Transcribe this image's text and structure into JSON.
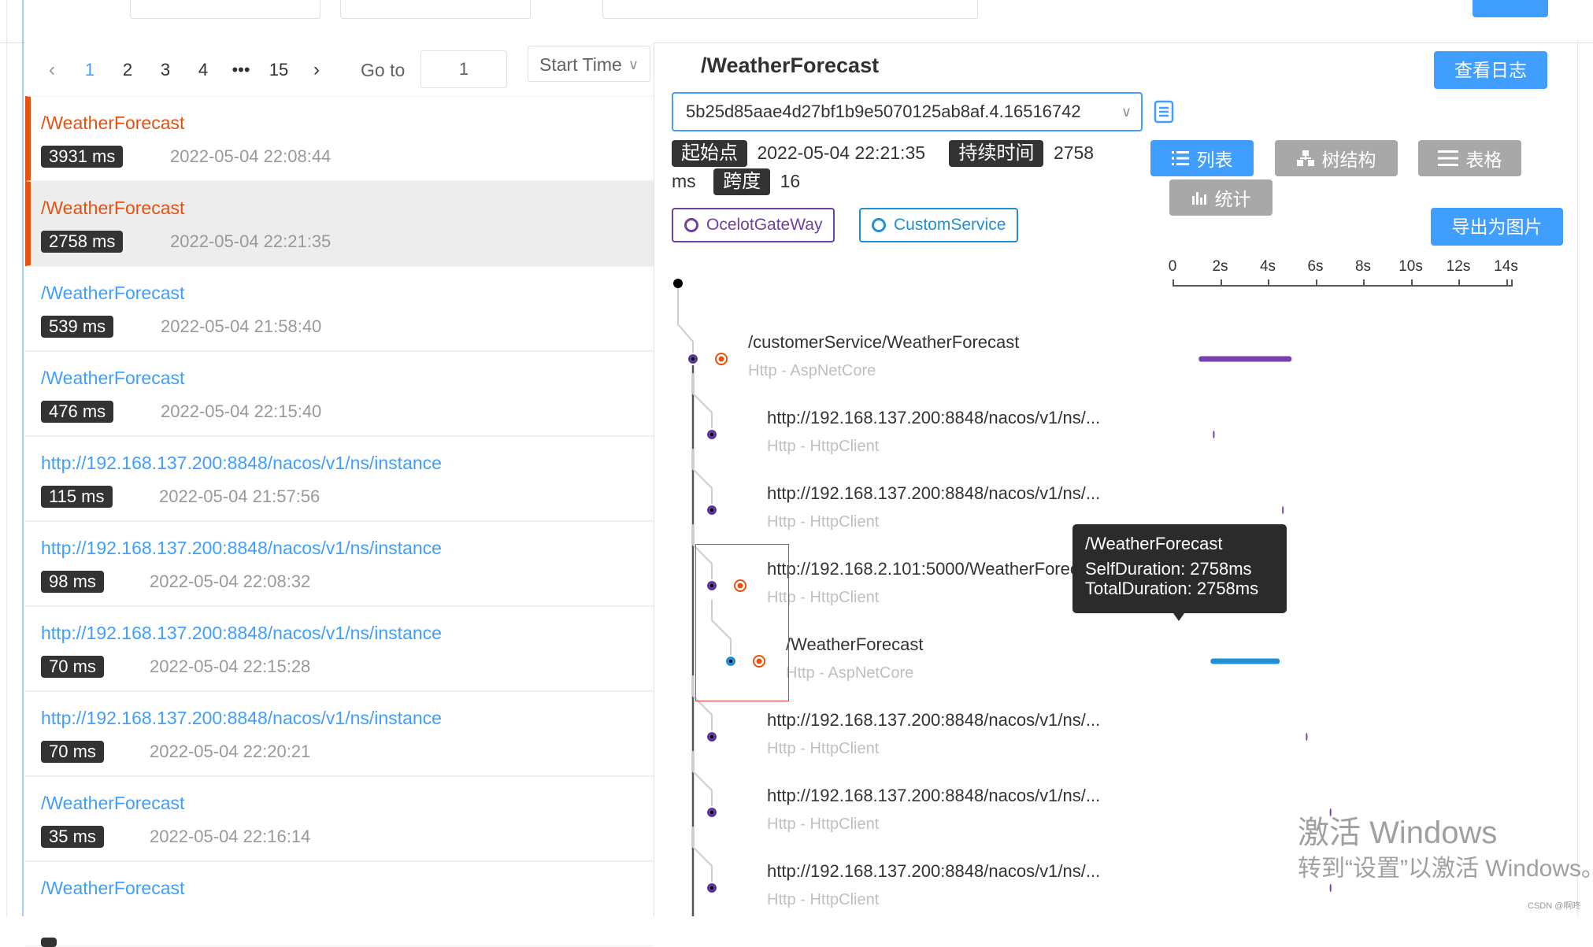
{
  "pagination": {
    "pages": [
      "1",
      "2",
      "3",
      "4",
      "•••",
      "15"
    ],
    "active_page": "1",
    "prev_icon": "chevron-left-icon",
    "next_icon": "chevron-right-icon",
    "goto_label": "Go to",
    "goto_value": "1",
    "sort_value": "Start Time"
  },
  "traces": [
    {
      "name": "/WeatherForecast",
      "duration": "3931 ms",
      "time": "2022-05-04 22:08:44",
      "error": true,
      "selected": false
    },
    {
      "name": "/WeatherForecast",
      "duration": "2758 ms",
      "time": "2022-05-04 22:21:35",
      "error": true,
      "selected": true
    },
    {
      "name": "/WeatherForecast",
      "duration": "539 ms",
      "time": "2022-05-04 21:58:40",
      "error": false,
      "selected": false
    },
    {
      "name": "/WeatherForecast",
      "duration": "476 ms",
      "time": "2022-05-04 22:15:40",
      "error": false,
      "selected": false
    },
    {
      "name": "http://192.168.137.200:8848/nacos/v1/ns/instance",
      "duration": "115 ms",
      "time": "2022-05-04 21:57:56",
      "error": false,
      "selected": false
    },
    {
      "name": "http://192.168.137.200:8848/nacos/v1/ns/instance",
      "duration": "98 ms",
      "time": "2022-05-04 22:08:32",
      "error": false,
      "selected": false
    },
    {
      "name": "http://192.168.137.200:8848/nacos/v1/ns/instance",
      "duration": "70 ms",
      "time": "2022-05-04 22:15:28",
      "error": false,
      "selected": false
    },
    {
      "name": "http://192.168.137.200:8848/nacos/v1/ns/instance",
      "duration": "70 ms",
      "time": "2022-05-04 22:20:21",
      "error": false,
      "selected": false
    },
    {
      "name": "/WeatherForecast",
      "duration": "35 ms",
      "time": "2022-05-04 22:16:14",
      "error": false,
      "selected": false
    },
    {
      "name": "/WeatherForecast",
      "duration": "",
      "time": "",
      "error": false,
      "selected": false
    }
  ],
  "detail": {
    "endpoint": "/WeatherForecast",
    "log_button": "查看日志",
    "trace_id": "5b25d85aae4d27bf1b9e5070125ab8af.4.16516742",
    "start_label": "起始点",
    "start_value": "2022-05-04 22:21:35",
    "duration_label": "持续时间",
    "duration_value": "2758",
    "duration_unit": "ms",
    "span_label": "跨度",
    "span_value": "16",
    "views": {
      "list": "列表",
      "tree": "树结构",
      "table": "表格",
      "stats": "统计"
    },
    "services": [
      {
        "name": "OcelotGateWay",
        "color": "#6f3fa3"
      },
      {
        "name": "CustomService",
        "color": "#1f8fd6"
      }
    ],
    "export_button": "导出为图片",
    "axis_ticks": [
      "0",
      "2s",
      "4s",
      "6s",
      "8s",
      "10s",
      "12s",
      "14s"
    ],
    "spans": [
      {
        "name": "/customerService/WeatherForecast",
        "type": "Http - AspNetCore",
        "dot": "#5c3a96",
        "error": true,
        "bar_color": "#7a3fb0",
        "start_s": 1.1,
        "dur_s": 3.9
      },
      {
        "name": "http://192.168.137.200:8848/nacos/v1/ns/...",
        "type": "Http - HttpClient",
        "dot": "#5c3a96",
        "error": false,
        "bar_color": "#7a3fb0",
        "start_s": 1.7,
        "dur_s": 0.05
      },
      {
        "name": "http://192.168.137.200:8848/nacos/v1/ns/...",
        "type": "Http - HttpClient",
        "dot": "#5c3a96",
        "error": false,
        "bar_color": "#7a3fb0",
        "start_s": 4.6,
        "dur_s": 0.05
      },
      {
        "name": "http://192.168.2.101:5000/WeatherForecast",
        "type": "Http - HttpClient",
        "dot": "#5c3a96",
        "error": true,
        "bar_color": "#7a3fb0",
        "start_s": 4.8,
        "dur_s": 0.0
      },
      {
        "name": "/WeatherForecast",
        "type": "Http - AspNetCore",
        "dot": "#1f8fd6",
        "error": true,
        "bar_color": "#1f8fd6",
        "start_s": 1.6,
        "dur_s": 2.9
      },
      {
        "name": "http://192.168.137.200:8848/nacos/v1/ns/...",
        "type": "Http - HttpClient",
        "dot": "#5c3a96",
        "error": false,
        "bar_color": "#7a3fb0",
        "start_s": 5.6,
        "dur_s": 0.05
      },
      {
        "name": "http://192.168.137.200:8848/nacos/v1/ns/...",
        "type": "Http - HttpClient",
        "dot": "#5c3a96",
        "error": false,
        "bar_color": "#7a3fb0",
        "start_s": 6.6,
        "dur_s": 0.05
      },
      {
        "name": "http://192.168.137.200:8848/nacos/v1/ns/...",
        "type": "Http - HttpClient",
        "dot": "#5c3a96",
        "error": false,
        "bar_color": "#7a3fb0",
        "start_s": 6.6,
        "dur_s": 0.05
      }
    ],
    "tooltip": {
      "title": "/WeatherForecast",
      "self": "SelfDuration: 2758ms",
      "total": "TotalDuration: 2758ms"
    }
  },
  "watermark": {
    "line1": "激活 Windows",
    "line2": "转到“设置”以激活 Windows。"
  },
  "credit": "CSDN @啊咚"
}
